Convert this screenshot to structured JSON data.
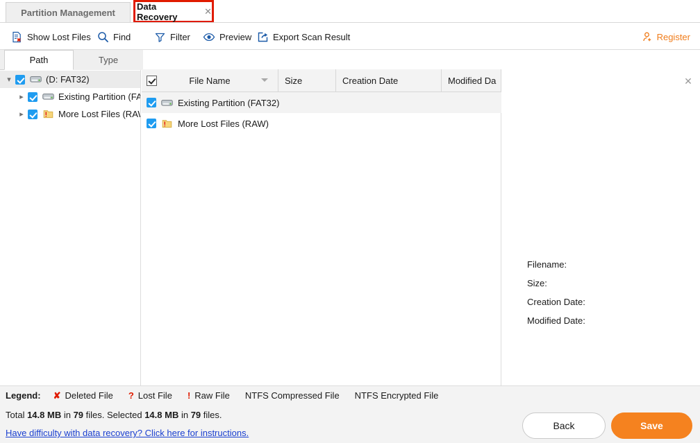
{
  "window_tabs": [
    {
      "label": "Partition Management",
      "active": false,
      "closable": false
    },
    {
      "label": "Data Recovery",
      "active": true,
      "closable": true,
      "close_glyph": "✕",
      "highlight_color": "#e01b00"
    }
  ],
  "toolbar": {
    "show_lost_files": "Show Lost Files",
    "find": "Find",
    "filter": "Filter",
    "preview": "Preview",
    "export_scan_result": "Export Scan Result",
    "register": "Register",
    "register_color": "#f07c1a",
    "icons": {
      "show_lost_files": "document-x-icon",
      "find": "search-icon",
      "filter": "funnel-icon",
      "preview": "eye-icon",
      "export": "export-arrow-icon",
      "register": "person-add-icon"
    }
  },
  "left_panel": {
    "tabs": [
      {
        "label": "Path",
        "active": true
      },
      {
        "label": "Type",
        "active": false
      }
    ],
    "tree": [
      {
        "label": "(D: FAT32)",
        "depth": 0,
        "expanded": true,
        "checked": true,
        "icon": "drive-icon",
        "selected": true
      },
      {
        "label": "Existing Partition (FA...",
        "depth": 1,
        "expanded": false,
        "checked": true,
        "icon": "drive-icon",
        "selected": false
      },
      {
        "label": "More Lost Files (RAW)",
        "depth": 1,
        "expanded": false,
        "checked": true,
        "icon": "folder-warning-icon",
        "selected": false
      }
    ]
  },
  "file_list": {
    "select_all_checked": true,
    "columns": [
      {
        "key": "name",
        "label": "File Name",
        "sorted": true,
        "sort_dir": "desc"
      },
      {
        "key": "size",
        "label": "Size"
      },
      {
        "key": "created",
        "label": "Creation Date"
      },
      {
        "key": "modified",
        "label": "Modified Da"
      }
    ],
    "rows": [
      {
        "name": "Existing Partition (FAT32)",
        "size": "",
        "created": "",
        "modified": "",
        "checked": true,
        "icon": "drive-icon"
      },
      {
        "name": "More Lost Files (RAW)",
        "size": "",
        "created": "",
        "modified": "",
        "checked": true,
        "icon": "folder-warning-icon"
      }
    ]
  },
  "preview_panel": {
    "close_glyph": "✕",
    "meta": [
      {
        "label": "Filename:",
        "value": ""
      },
      {
        "label": "Size:",
        "value": ""
      },
      {
        "label": "Creation Date:",
        "value": ""
      },
      {
        "label": "Modified Date:",
        "value": ""
      }
    ]
  },
  "legend": {
    "title": "Legend:",
    "items": [
      {
        "mark": "✘",
        "label": "Deleted File",
        "mark_color": "#e01b00"
      },
      {
        "mark": "?",
        "label": "Lost File",
        "mark_color": "#e01b00"
      },
      {
        "mark": "!",
        "label": "Raw File",
        "mark_color": "#e01b00"
      },
      {
        "mark": "",
        "label": "NTFS Compressed File",
        "mark_color": ""
      },
      {
        "mark": "",
        "label": "NTFS Encrypted File",
        "mark_color": ""
      }
    ]
  },
  "status": {
    "total_prefix": "Total ",
    "total_size": "14.8 MB",
    "total_mid": " in ",
    "total_count": "79",
    "total_suffix": " files.  ",
    "selected_prefix": "Selected ",
    "selected_size": "14.8 MB",
    "selected_mid": " in ",
    "selected_count": "79",
    "selected_suffix": " files.",
    "help_link": "Have difficulty with data recovery? Click here for instructions."
  },
  "buttons": {
    "back": "Back",
    "save": "Save",
    "save_color": "#f5821f"
  }
}
